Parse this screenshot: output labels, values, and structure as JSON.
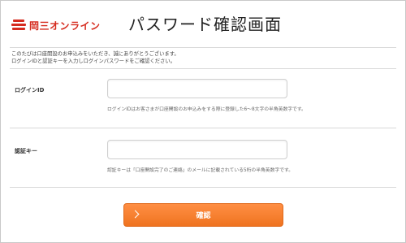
{
  "brand": {
    "name": "岡三オンライン",
    "accent_color": "#d52b1e",
    "logo_icon": "okasan-logo-icon"
  },
  "page": {
    "title": "パスワード確認画面"
  },
  "intro": {
    "line1": "このたびは口座開設のお申込みをいただき、誠にありがとうございます。",
    "line2": "ログインIDと認証キーを入力しログインパスワードをご確認ください。"
  },
  "form": {
    "login_id": {
      "label": "ログインID",
      "value": "",
      "help": "ログインIDはお客さまが口座開設のお申込みをする際に登録した6〜8文字の半角英数字です。"
    },
    "auth_key": {
      "label": "認証キー",
      "value": "",
      "help": "認証キーは「口座開設完了のご連絡」のメールに記載されている5桁の半角英数字です。"
    },
    "submit": {
      "label": "確認",
      "icon": "chevron-right-icon",
      "color": "#f07a2a"
    }
  }
}
